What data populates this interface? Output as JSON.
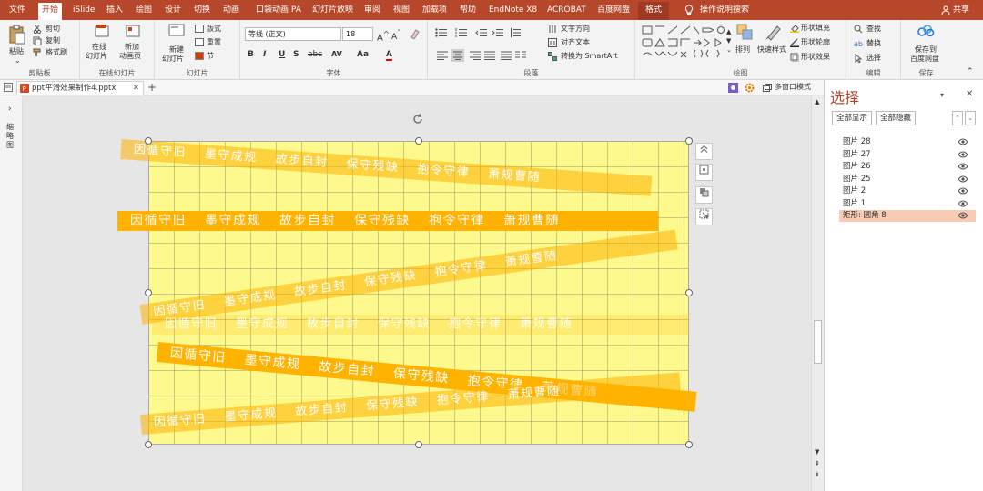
{
  "tabs": [
    "文件",
    "开始",
    "iSlide",
    "插入",
    "绘图",
    "设计",
    "切换",
    "动画",
    "口袋动画 PA",
    "幻灯片放映",
    "审阅",
    "视图",
    "加载项",
    "帮助",
    "EndNote X8",
    "ACROBAT",
    "百度网盘",
    "格式"
  ],
  "active_tab": "开始",
  "search": "操作说明搜索",
  "share": "共享",
  "ribbon": {
    "clipboard": {
      "paste": "粘贴",
      "cut": "剪切",
      "copy": "复制",
      "format_painter": "格式刷",
      "label": "剪贴板"
    },
    "online_slides": {
      "online": "在线",
      "online2": "幻灯片",
      "newanim": "新加",
      "newanim2": "动画页",
      "label": "在线幻灯片"
    },
    "slides": {
      "new": "新建",
      "new2": "幻灯片",
      "layout": "版式",
      "reset": "重置",
      "section": "节",
      "label": "幻灯片"
    },
    "font": {
      "name": "等线 (正文)",
      "size": "18",
      "bold": "B",
      "italic": "I",
      "underline": "U",
      "strike": "S",
      "spacing": "AV",
      "case": "Aa",
      "color": "A",
      "label": "字体"
    },
    "paragraph": {
      "dir": "文字方向",
      "align": "对齐文本",
      "smartart": "转换为 SmartArt",
      "label": "段落"
    },
    "drawing": {
      "arrange": "排列",
      "quick": "快速样式",
      "fill": "形状填充",
      "outline": "形状轮廓",
      "effect": "形状效果",
      "label": "绘图"
    },
    "editing": {
      "find": "查找",
      "replace": "替换",
      "select": "选择",
      "label": "编辑"
    },
    "save": {
      "save1": "保存到",
      "save2": "百度网盘",
      "label": "保存"
    }
  },
  "doc_tab": "ppt平滑效果制作4.pptx",
  "view_mode": "多窗口模式",
  "left_rail": "缩略图",
  "slide": {
    "phrases": [
      "因循守旧",
      "墨守成规",
      "故步自封",
      "保守残缺",
      "抱令守律",
      "萧规曹随"
    ],
    "accent": "#ffb300",
    "background": "#fdf98c"
  },
  "pane": {
    "title": "选择",
    "show_all": "全部显示",
    "hide_all": "全部隐藏",
    "items": [
      "图片 28",
      "图片 27",
      "图片 26",
      "图片 25",
      "图片 2",
      "图片 1",
      "矩形: 圆角 8"
    ],
    "selected": "矩形: 圆角 8"
  }
}
